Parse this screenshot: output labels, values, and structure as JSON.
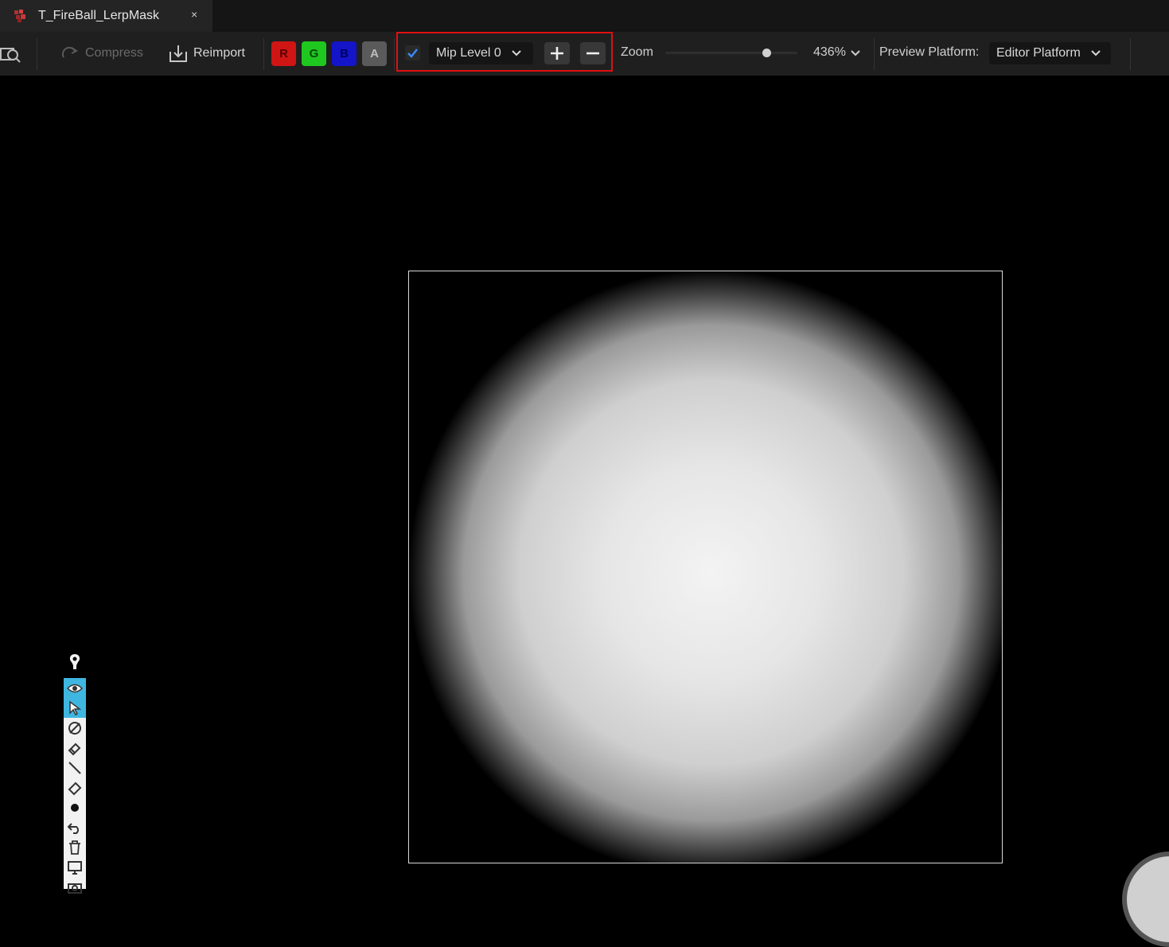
{
  "tab": {
    "title": "T_FireBall_LerpMask",
    "close": "×",
    "icon": "texture-asset-icon"
  },
  "toolbar": {
    "browse_icon": "browse-asset-icon",
    "compress_label": "Compress",
    "reimport_label": "Reimport",
    "channels": [
      {
        "label": "R",
        "color": "#d01515",
        "text_color": "#5a0000"
      },
      {
        "label": "G",
        "color": "#1fc81f",
        "text_color": "#064a06"
      },
      {
        "label": "B",
        "color": "#1414c8",
        "text_color": "#000060"
      },
      {
        "label": "A",
        "color": "#5a5a5a",
        "text_color": "#bdbdbd"
      }
    ],
    "mip_checkbox_checked": true,
    "mip_level": "Mip Level 0",
    "plus_label": "+",
    "minus_label": "−",
    "zoom_label": "Zoom",
    "zoom_slider_fraction": 0.77,
    "zoom_value": "436%",
    "preview_platform_label": "Preview Platform:",
    "preview_platform_value": "Editor Platform",
    "highlight_color": "#e01010"
  },
  "viewport": {
    "texture": "radial-white-mask"
  },
  "draw_tools": [
    "pen-icon",
    "eye-icon",
    "cursor-icon",
    "no-draw-icon",
    "highlighter-icon",
    "line-icon",
    "eraser-icon",
    "dot-icon",
    "undo-icon",
    "trash-icon",
    "screen-icon",
    "camera-icon"
  ]
}
